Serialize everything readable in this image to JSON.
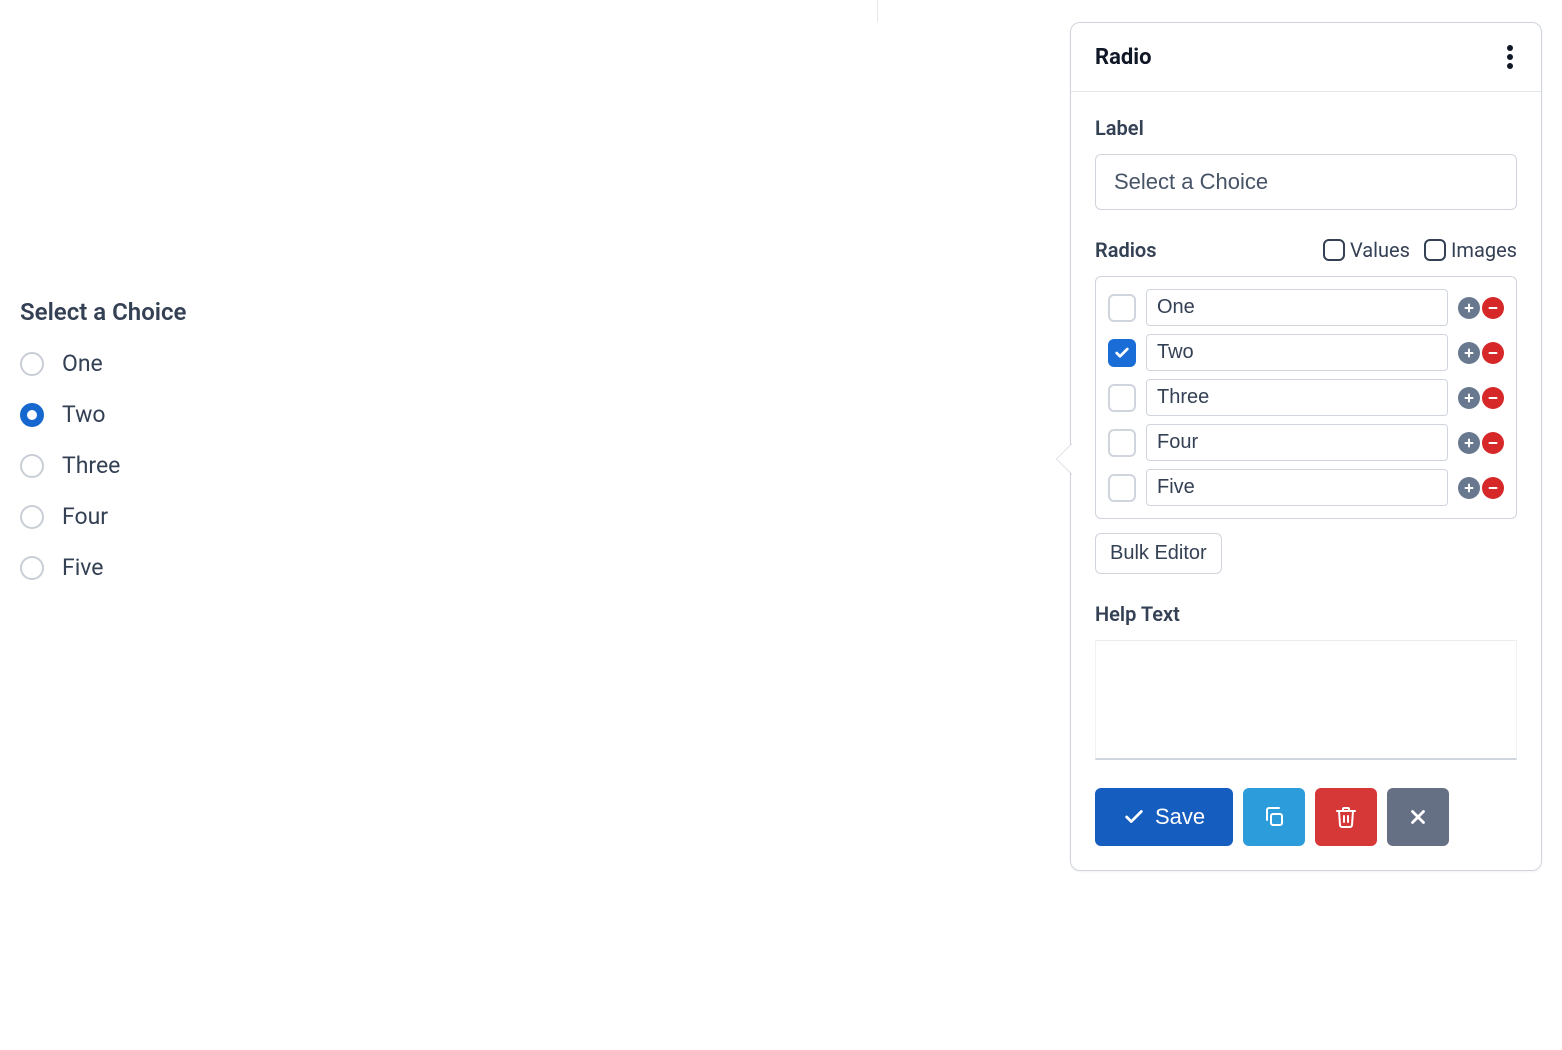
{
  "preview": {
    "label": "Select a Choice",
    "options": [
      {
        "text": "One",
        "selected": false
      },
      {
        "text": "Two",
        "selected": true
      },
      {
        "text": "Three",
        "selected": false
      },
      {
        "text": "Four",
        "selected": false
      },
      {
        "text": "Five",
        "selected": false
      }
    ]
  },
  "panel": {
    "title": "Radio",
    "label_field": {
      "label": "Label",
      "value": "Select a Choice"
    },
    "radios": {
      "title": "Radios",
      "values_checkbox": {
        "label": "Values",
        "checked": false
      },
      "images_checkbox": {
        "label": "Images",
        "checked": false
      },
      "items": [
        {
          "text": "One",
          "checked": false
        },
        {
          "text": "Two",
          "checked": true
        },
        {
          "text": "Three",
          "checked": false
        },
        {
          "text": "Four",
          "checked": false
        },
        {
          "text": "Five",
          "checked": false
        }
      ]
    },
    "bulk_editor_label": "Bulk Editor",
    "help_text": {
      "label": "Help Text",
      "value": ""
    },
    "actions": {
      "save": "Save"
    }
  }
}
